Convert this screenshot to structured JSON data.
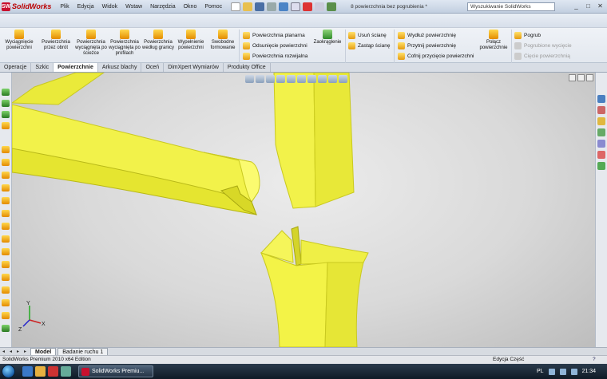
{
  "app": {
    "logo_letters": "SW",
    "name": "SolidWorks",
    "doc_title": "8 powierzchnia bez pogrubienia *",
    "search_placeholder": "Wyszukiwanie SolidWorks",
    "window_buttons": [
      "_",
      "□",
      "✕"
    ]
  },
  "menu": [
    "Plik",
    "Edycja",
    "Widok",
    "Wstaw",
    "Narzędzia",
    "Okno",
    "Pomoc"
  ],
  "ribbon": {
    "tools": [
      {
        "label": "Wyciągnięcie powierzchni"
      },
      {
        "label": "Powierzchnia przez obrót"
      },
      {
        "label": "Powierzchnia wyciągnięta po ścieżce"
      },
      {
        "label": "Powierzchnia wyciągnięta po profilach"
      },
      {
        "label": "Powierzchnia według granicy"
      },
      {
        "label": "Wypełnienie powierzchni"
      },
      {
        "label": "Swobodne formowanie"
      }
    ],
    "group1": [
      "Powierzchnia planarna",
      "Odsunięcie powierzchni",
      "Powierzchnia rozwijalna"
    ],
    "zaokraglenie": "Zaokrąglenie",
    "group2": [
      "Usuń ścianę",
      "Zastąp ścianę"
    ],
    "group3": [
      "Wydłuż powierzchnię",
      "Przytnij powierzchnię",
      "Cofnij przycięcie powierzchni"
    ],
    "polacz": "Połącz powierzchnie",
    "group4": [
      {
        "label": "Pogrub",
        "disabled": false
      },
      {
        "label": "Pogrubione wycięcie",
        "disabled": true
      },
      {
        "label": "Cięcie powierzchnią",
        "disabled": true
      }
    ]
  },
  "tabs": [
    {
      "label": "Operacje",
      "active": false
    },
    {
      "label": "Szkic",
      "active": false
    },
    {
      "label": "Powierzchnie",
      "active": true
    },
    {
      "label": "Arkusz blachy",
      "active": false
    },
    {
      "label": "Oceń",
      "active": false
    },
    {
      "label": "DimXpert Wymiarów",
      "active": false
    },
    {
      "label": "Produkty Office",
      "active": false
    }
  ],
  "model_tabs": [
    {
      "label": "Model",
      "active": true
    },
    {
      "label": "Badanie ruchu 1",
      "active": false
    }
  ],
  "triad": {
    "x": "X",
    "y": "Y",
    "z": "Z"
  },
  "status": {
    "left": "SolidWorks Premium 2010 x64 Edition",
    "mode": "Edycja Część",
    "help": "?"
  },
  "taskbar": {
    "task": "SolidWorks Premiu...",
    "lang": "PL",
    "time": "21:34"
  },
  "colors": {
    "part": "#f3f347",
    "part_shade": "#c9c920",
    "accent": "#c8102e"
  }
}
